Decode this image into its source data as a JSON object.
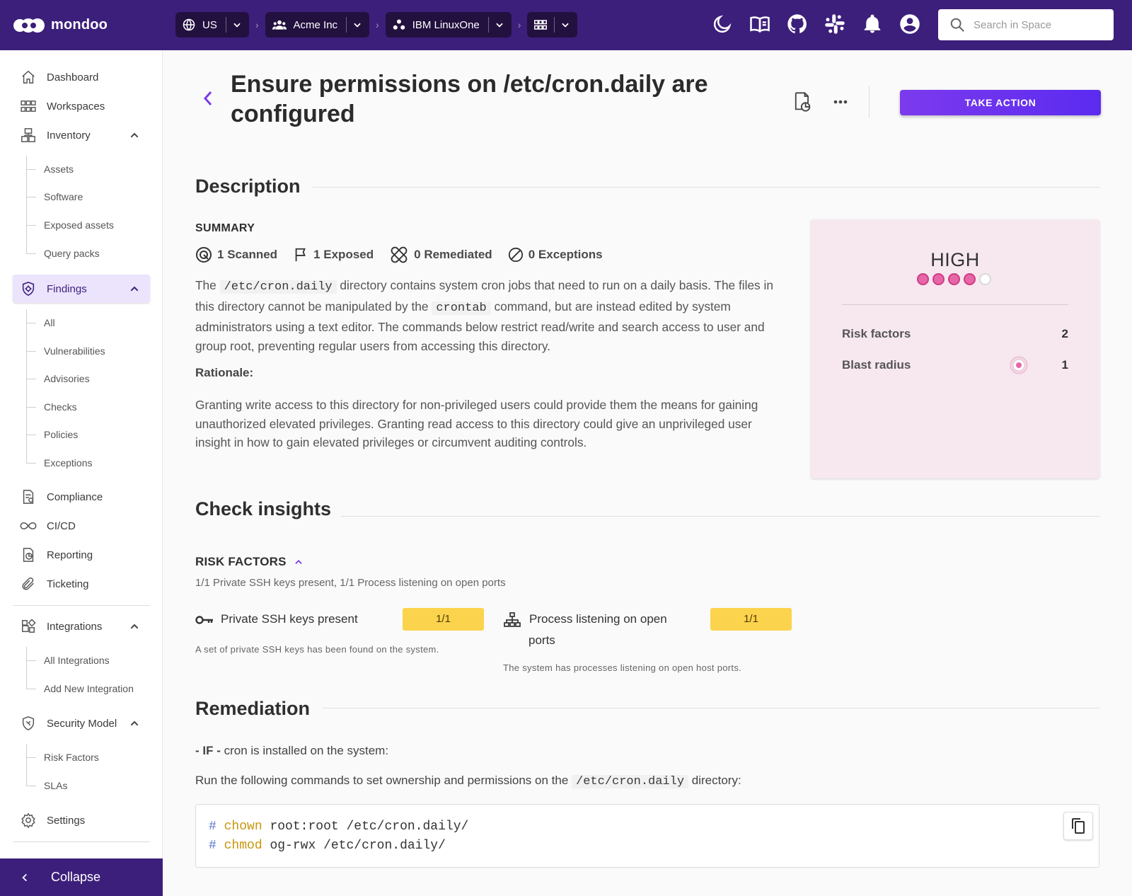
{
  "brand": {
    "name": "mondoo"
  },
  "breadcrumbs": [
    {
      "label": "US",
      "icon": "globe-icon"
    },
    {
      "label": "Acme Inc",
      "icon": "organization-icon"
    },
    {
      "label": "IBM LinuxOne",
      "icon": "space-icon"
    },
    {
      "label": "",
      "icon": "workspace-icon"
    }
  ],
  "topbar_icons": [
    "dark-mode-icon",
    "docs-icon",
    "github-icon",
    "slack-icon",
    "notifications-icon",
    "account-icon"
  ],
  "search": {
    "placeholder": "Search in Space"
  },
  "sidebar": {
    "dashboard": "Dashboard",
    "workspaces": "Workspaces",
    "inventory": "Inventory",
    "inventory_items": [
      "Assets",
      "Software",
      "Exposed assets",
      "Query packs"
    ],
    "findings": "Findings",
    "findings_items": [
      "All",
      "Vulnerabilities",
      "Advisories",
      "Checks",
      "Policies",
      "Exceptions"
    ],
    "compliance": "Compliance",
    "cicd": "CI/CD",
    "reporting": "Reporting",
    "ticketing": "Ticketing",
    "integrations": "Integrations",
    "integrations_items": [
      "All Integrations",
      "Add New Integration"
    ],
    "security_model": "Security Model",
    "security_model_items": [
      "Risk Factors",
      "SLAs"
    ],
    "settings": "Settings",
    "collapse": "Collapse"
  },
  "header": {
    "title": "Ensure permissions on /etc/cron.daily are configured",
    "take_action": "TAKE ACTION"
  },
  "description": {
    "title": "Description",
    "summary_label": "SUMMARY",
    "stats": {
      "scanned": {
        "count": "1",
        "label": "Scanned"
      },
      "exposed": {
        "count": "1",
        "label": "Exposed"
      },
      "remediated": {
        "count": "0",
        "label": "Remediated"
      },
      "exceptions": {
        "count": "0",
        "label": "Exceptions"
      }
    },
    "para1": {
      "t1": "The ",
      "c1": "/etc/cron.daily",
      "t2": " directory contains system cron jobs that need to run on a daily basis. The files in this directory cannot be manipulated by the ",
      "c2": "crontab",
      "t3": " command, but are instead edited by system administrators using a text editor. The commands below restrict read/write and search access to user and group root, preventing regular users from accessing this directory."
    },
    "rationale_label": "Rationale:",
    "rationale": "Granting write access to this directory for non-privileged users could provide them the means for gaining unauthorized elevated privileges. Granting read access to this directory could give an unprivileged user insight in how to gain elevated privileges or circumvent auditing controls."
  },
  "risk_card": {
    "level": "HIGH",
    "level_dots_filled": 4,
    "level_dots_total": 5,
    "risk_factors_label": "Risk factors",
    "risk_factors_value": "2",
    "blast_radius_label": "Blast radius",
    "blast_radius_value": "1"
  },
  "check_insights": {
    "title": "Check insights",
    "risk_factors_header": "RISK FACTORS",
    "risk_factors_summary": "1/1 Private SSH keys present, 1/1 Process listening on open ports",
    "factors": [
      {
        "icon": "key-icon",
        "label": "Private SSH keys present",
        "count": "1/1",
        "description": "A set of private SSH keys has been found on the system."
      },
      {
        "icon": "network-icon",
        "label_line1": "Process listening on open",
        "label_line2": "ports",
        "count": "1/1",
        "description": "The system has processes listening on open host ports."
      }
    ]
  },
  "remediation": {
    "title": "Remediation",
    "if_prefix": "- IF -",
    "if_text": " cron is installed on the system:",
    "run_text1": "Run the following commands to set ownership and permissions on the ",
    "run_code": "/etc/cron.daily",
    "run_text2": " directory:",
    "code_lines": [
      {
        "hash": "#",
        "cmd": "chown",
        "args": "root:root /etc/cron.daily/"
      },
      {
        "hash": "#",
        "cmd": "chmod",
        "args": "og-rwx /etc/cron.daily/"
      }
    ]
  },
  "colors": {
    "topbar": "#3c1f7b",
    "accent": "#7c3aed",
    "risk_high": "#e667a7",
    "risk_card_bg": "#f7e8ef",
    "badge": "#fcd34d"
  }
}
